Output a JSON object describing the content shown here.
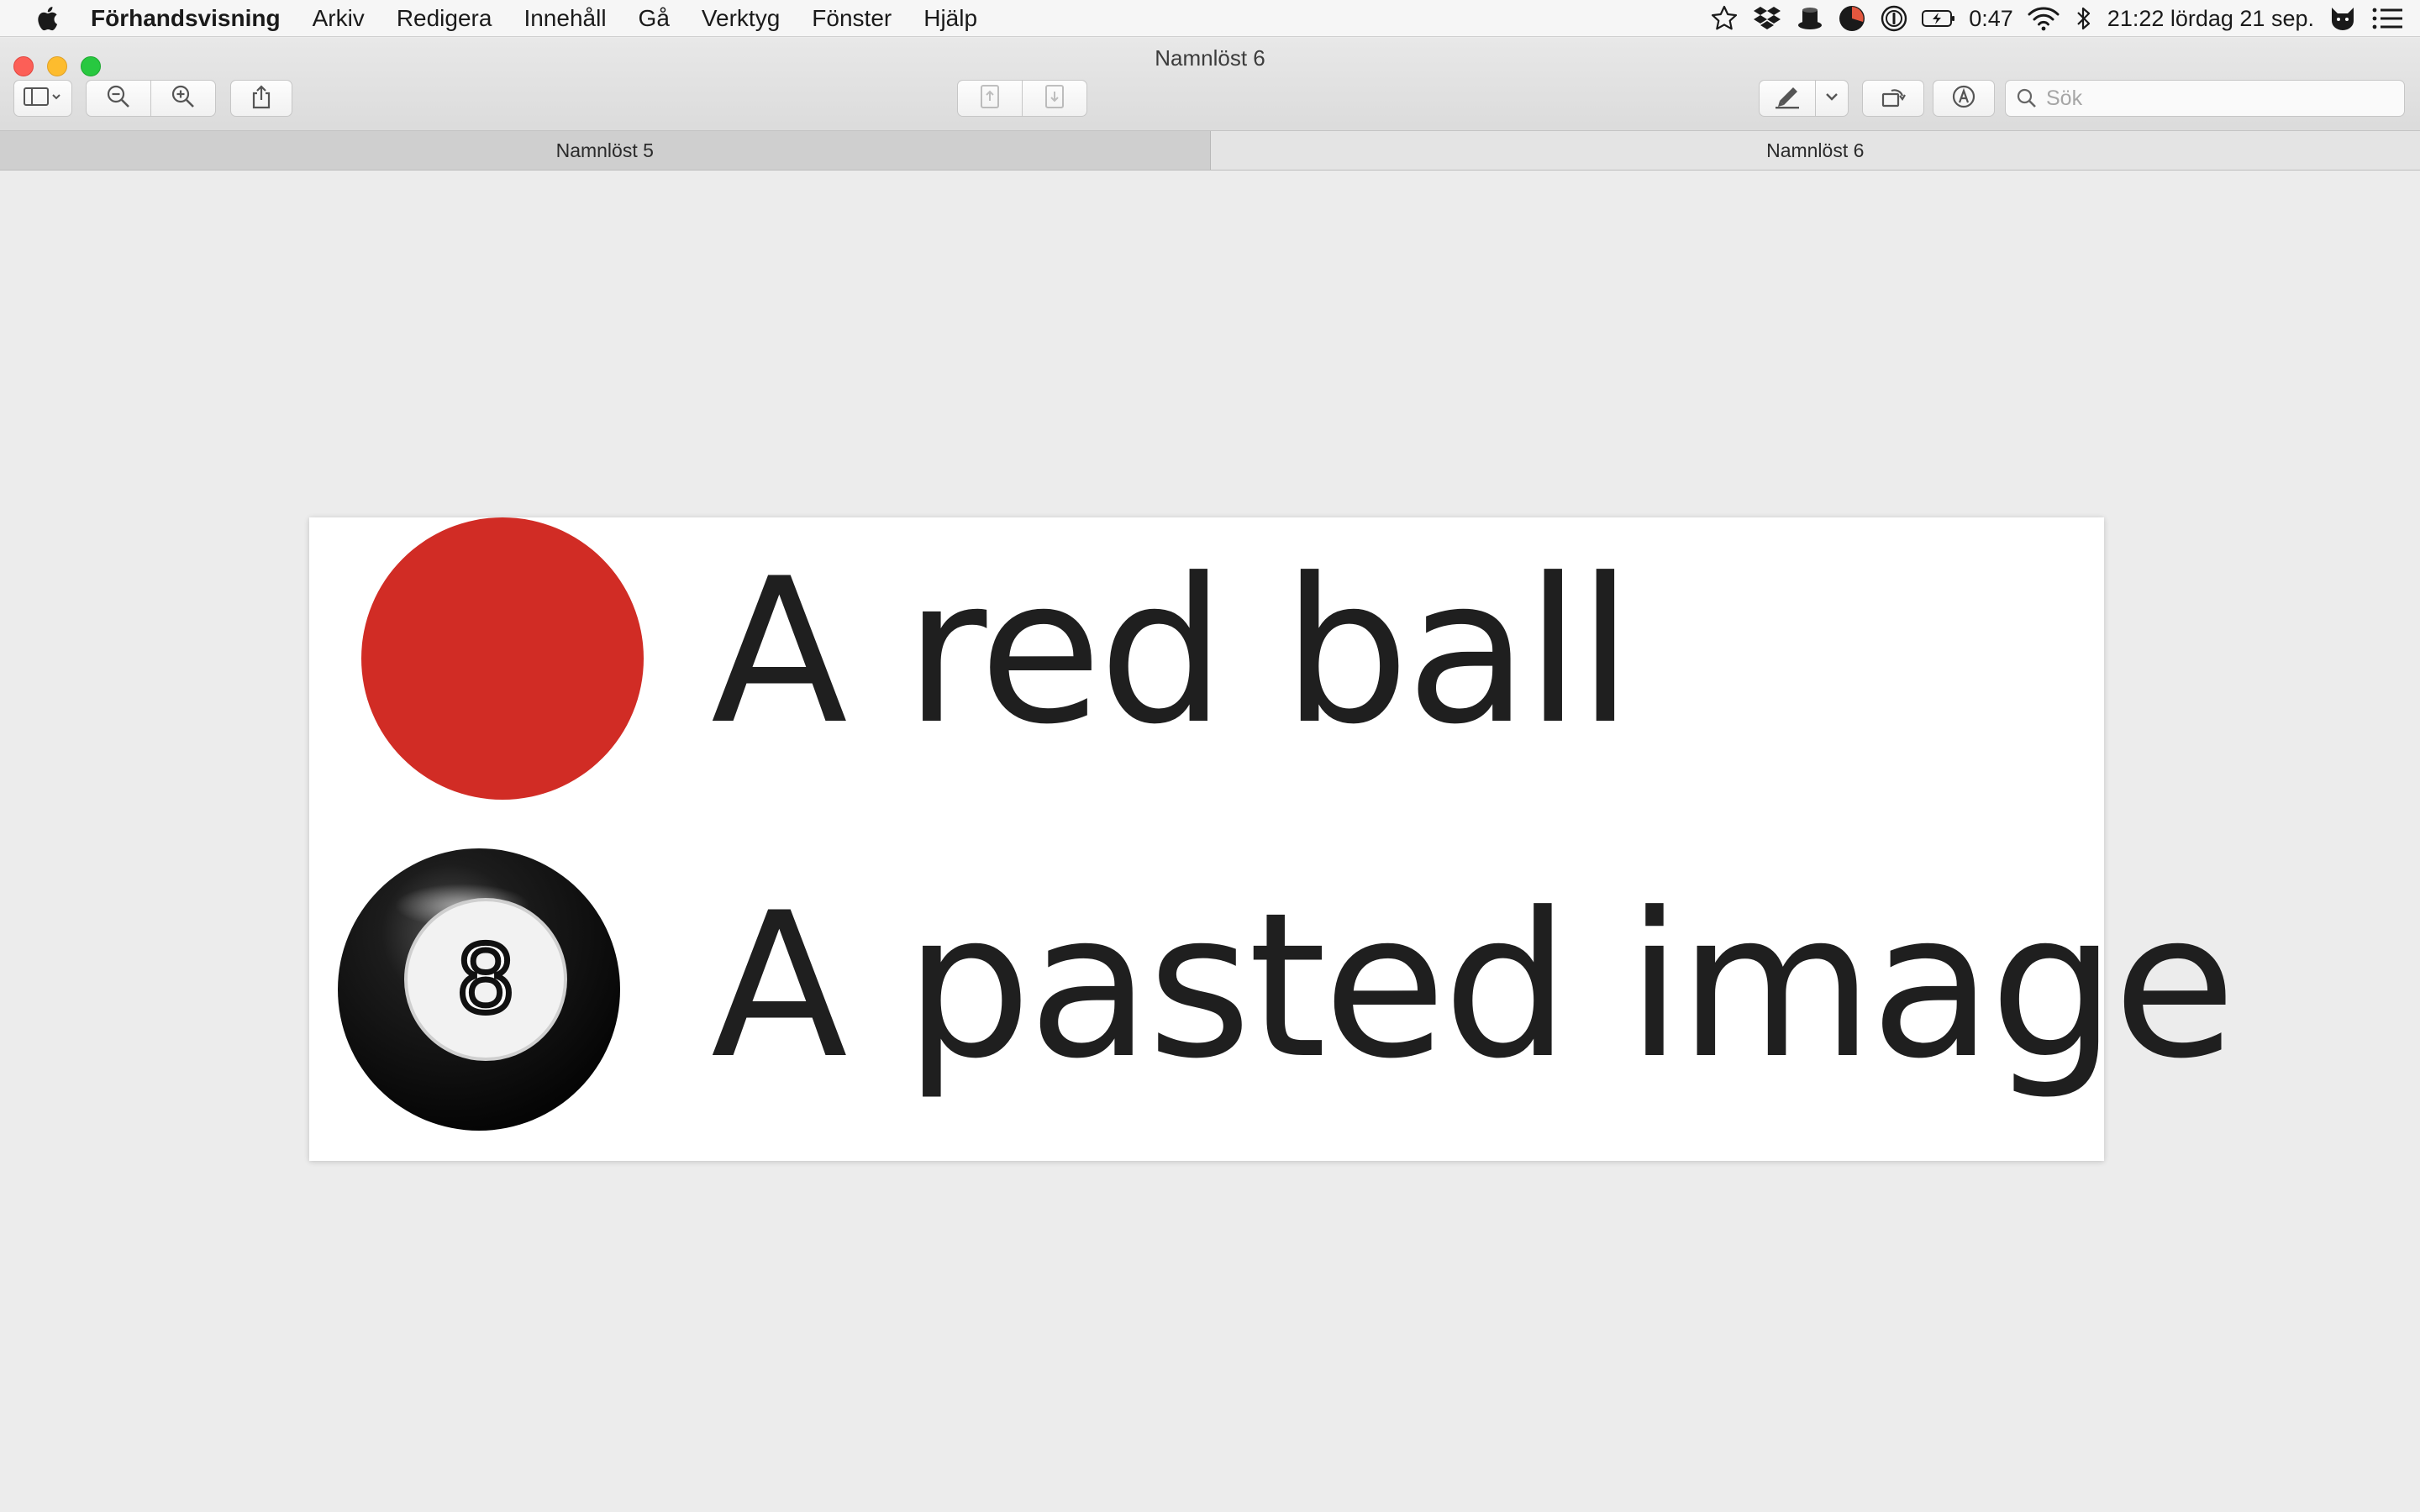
{
  "menubar": {
    "app_name": "Förhandsvisning",
    "menus": [
      "Arkiv",
      "Redigera",
      "Innehåll",
      "Gå",
      "Verktyg",
      "Fönster",
      "Hjälp"
    ],
    "status": {
      "battery_time": "0:47",
      "clock": "21:22 lördag 21 sep."
    }
  },
  "window": {
    "title": "Namnlöst 6",
    "tabs": [
      {
        "label": "Namnlöst 5",
        "active": false
      },
      {
        "label": "Namnlöst 6",
        "active": true
      }
    ],
    "search": {
      "placeholder": "Sök",
      "value": ""
    }
  },
  "document": {
    "line1": "A red ball",
    "line2": "A pasted image",
    "eight_ball_number": "8",
    "red_ball_color": "#d12c25"
  },
  "icons": {
    "toolbar": [
      "sidebar-icon",
      "zoom-out-icon",
      "zoom-in-icon",
      "share-icon",
      "page-up-icon",
      "page-down-icon",
      "markup-pen-icon",
      "rotate-icon",
      "annotate-icon",
      "search-icon"
    ],
    "status": [
      "star-icon",
      "dropbox-icon",
      "hat-icon",
      "pie-icon",
      "password-icon",
      "battery-icon",
      "wifi-icon",
      "bluetooth-icon",
      "cat-icon",
      "list-icon"
    ]
  }
}
